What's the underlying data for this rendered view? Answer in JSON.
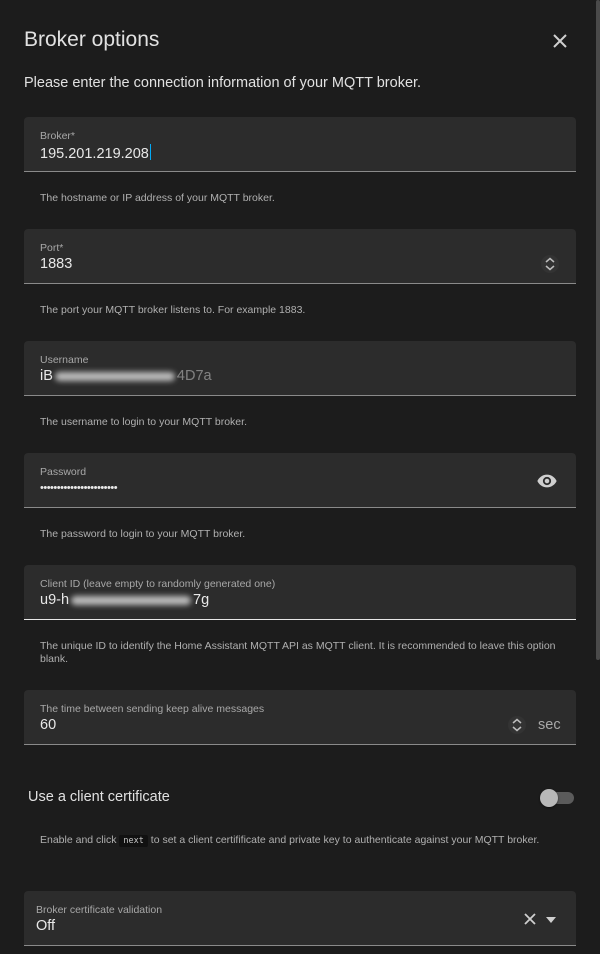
{
  "dialog": {
    "title": "Broker options",
    "intro": "Please enter the connection information of your MQTT broker."
  },
  "fields": {
    "broker": {
      "label": "Broker*",
      "value": "195.201.219.208",
      "helper": "The hostname or IP address of your MQTT broker."
    },
    "port": {
      "label": "Port*",
      "value": "1883",
      "helper": "The port your MQTT broker listens to. For example 1883."
    },
    "username": {
      "label": "Username",
      "value_prefix": "iB",
      "value_suffix": "4D7a",
      "helper": "The username to login to your MQTT broker."
    },
    "password": {
      "label": "Password",
      "value": "•••••••••••••••••••••••",
      "helper": "The password to login to your MQTT broker."
    },
    "client_id": {
      "label": "Client ID (leave empty to randomly generated one)",
      "value_prefix": "u9-h",
      "value_suffix": "7g",
      "helper": "The unique ID to identify the Home Assistant MQTT API as MQTT client. It is recommended to leave this option blank."
    },
    "keepalive": {
      "label": "The time between sending keep alive messages",
      "value": "60",
      "unit": "sec"
    }
  },
  "client_cert": {
    "label": "Use a client certificate",
    "enabled": false,
    "helper_before": "Enable and click",
    "helper_code": "next",
    "helper_after": "to set a client certifificate and private key to authenticate against your MQTT broker."
  },
  "cert_validation": {
    "label": "Broker certificate validation",
    "value": "Off"
  },
  "icons": {
    "close": "close-icon",
    "eye": "eye-icon",
    "spin": "unfold-icon",
    "clear": "clear-icon",
    "dropdown": "chevron-down-icon"
  },
  "colors": {
    "background": "#1c1c1c",
    "field": "#2c2c2c",
    "caret": "#03a9f4"
  }
}
